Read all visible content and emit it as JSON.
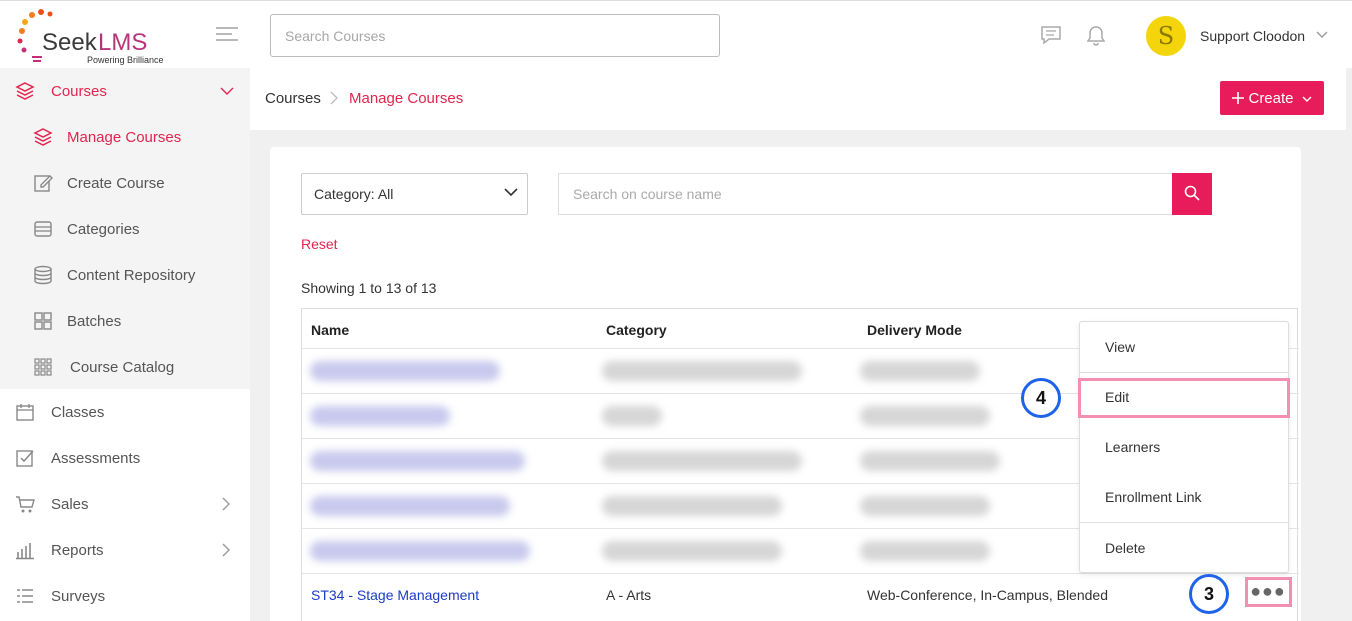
{
  "logo": {
    "name": "SeekLMS",
    "tagline": "Powering Brilliance"
  },
  "header": {
    "search_placeholder": "Search Courses",
    "user_name": "Support Cloodon",
    "avatar_initial": "S",
    "avatar_color": "#f4d40b"
  },
  "sidebar": {
    "courses": "Courses",
    "sub": [
      "Manage Courses",
      "Create Course",
      "Categories",
      "Content Repository",
      "Batches",
      "Course Catalog"
    ],
    "items": [
      "Classes",
      "Assessments",
      "Sales",
      "Reports",
      "Surveys"
    ]
  },
  "breadcrumb": {
    "root": "Courses",
    "current": "Manage Courses"
  },
  "create_button": "Create",
  "filters": {
    "category": "Category: All",
    "search_placeholder": "Search on course name",
    "reset": "Reset"
  },
  "showing": "Showing 1 to 13 of 13",
  "table": {
    "headers": [
      "Name",
      "Category",
      "Delivery Mode"
    ],
    "visible_row": {
      "name": "ST34 - Stage Management",
      "category": "A - Arts",
      "delivery_mode": "Web-Conference, In-Campus, Blended"
    }
  },
  "menu": [
    "View",
    "Edit",
    "Learners",
    "Enrollment Link",
    "Delete"
  ],
  "steps": {
    "edit": "4",
    "more": "3"
  },
  "colors": {
    "accent": "#e81c5a",
    "link": "#1a3dc9",
    "highlight": "#f48fb1",
    "step_ring": "#1e63e9"
  }
}
